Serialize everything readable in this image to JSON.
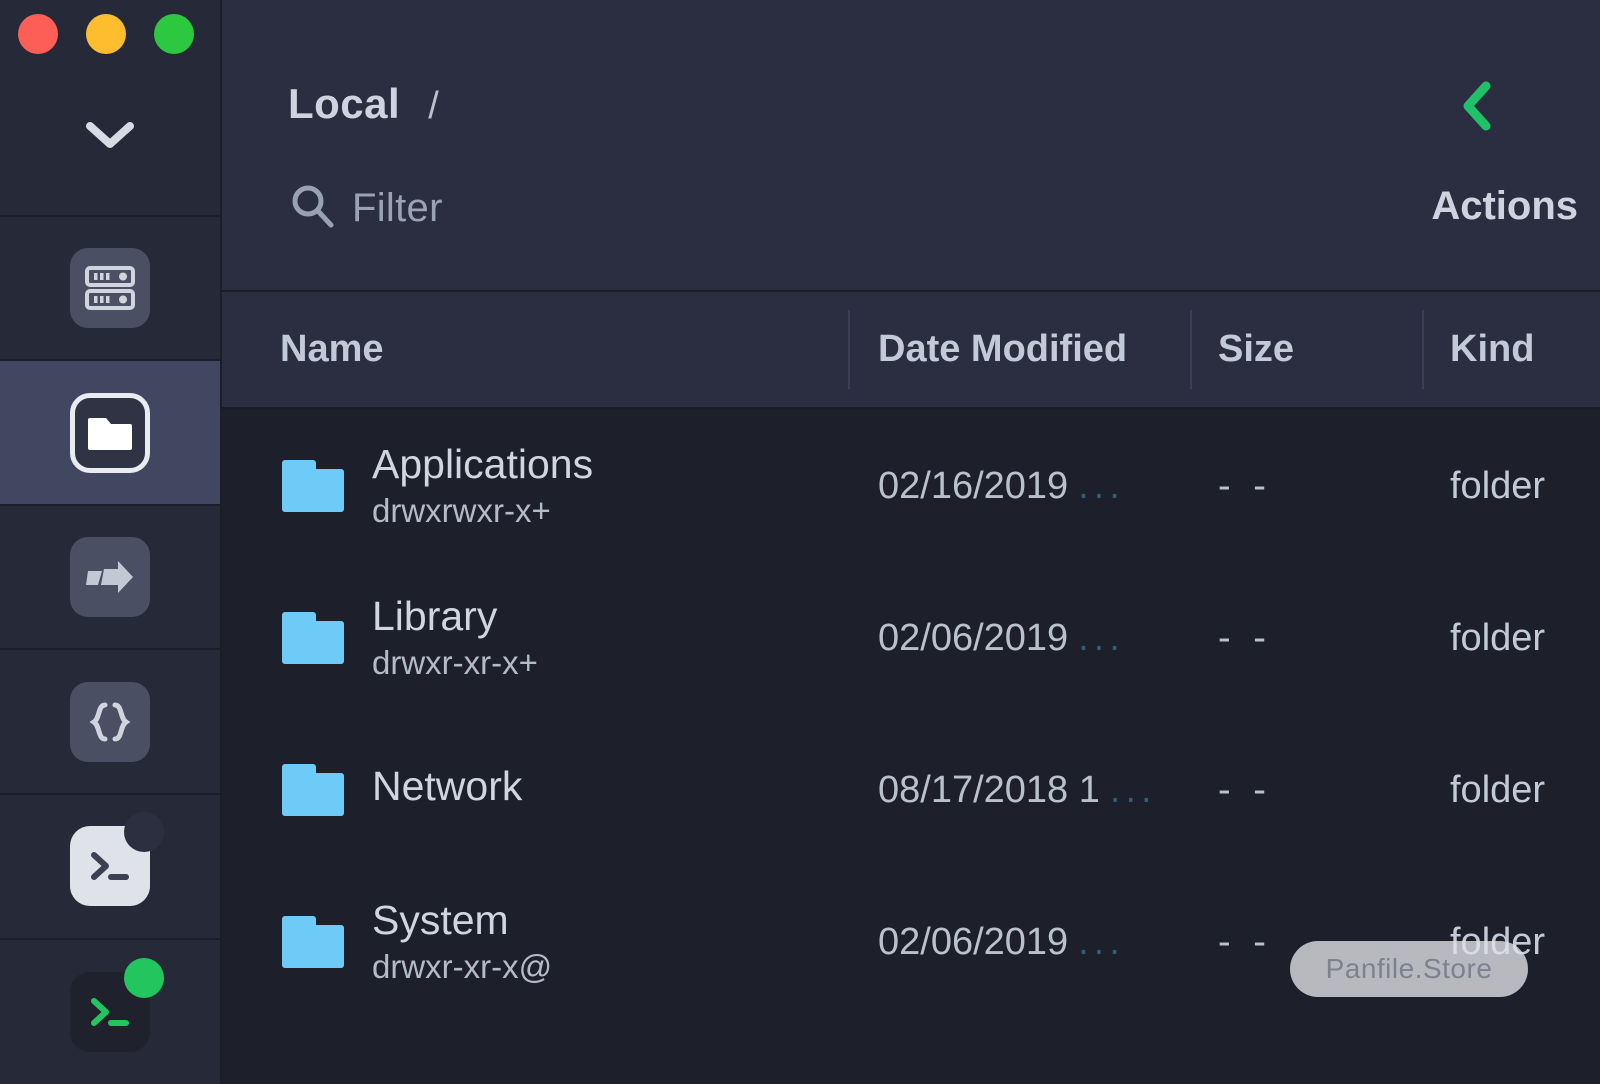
{
  "window": {
    "traffic_lights": [
      "close",
      "minimize",
      "zoom"
    ],
    "collapse_icon": "chevron-down-icon"
  },
  "sidebar": {
    "items": [
      {
        "icon": "server-icon",
        "label": "Servers",
        "selected": false
      },
      {
        "icon": "folder-icon",
        "label": "Files",
        "selected": true
      },
      {
        "icon": "transfers-arrow-icon",
        "label": "Transfers",
        "selected": false
      },
      {
        "icon": "code-braces-icon",
        "label": "Code",
        "selected": false
      },
      {
        "icon": "terminal-icon",
        "label": "Terminal",
        "selected": false,
        "badge": "dark"
      },
      {
        "icon": "terminal-active-icon",
        "label": "Session",
        "selected": false,
        "badge": "green"
      }
    ]
  },
  "toolbar": {
    "breadcrumb_root": "Local",
    "breadcrumb_separator": "/",
    "back_icon": "chevron-left-icon",
    "search_icon": "search-icon",
    "filter_placeholder": "Filter",
    "actions_label": "Actions"
  },
  "file_table": {
    "columns": [
      "Name",
      "Date Modified",
      "Size",
      "Kind"
    ],
    "rows": [
      {
        "icon": "folder-icon",
        "name": "Applications",
        "permissions": "drwxrwxr-x+",
        "date": "02/16/2019",
        "date_truncated": "...",
        "size": "- -",
        "kind": "folder"
      },
      {
        "icon": "folder-icon",
        "name": "Library",
        "permissions": "drwxr-xr-x+",
        "date": "02/06/2019",
        "date_truncated": "...",
        "size": "- -",
        "kind": "folder"
      },
      {
        "icon": "folder-icon",
        "name": "Network",
        "permissions": "",
        "date": "08/17/2018 1",
        "date_truncated": "...",
        "size": "- -",
        "kind": "folder"
      },
      {
        "icon": "folder-icon",
        "name": "System",
        "permissions": "drwxr-xr-x@",
        "date": "02/06/2019",
        "date_truncated": "...",
        "size": "- -",
        "kind": "folder"
      }
    ]
  },
  "watermark": {
    "text": "Panfile.Store"
  },
  "colors": {
    "sidebar_bg": "#262938",
    "sidebar_selected": "#414761",
    "toolbar_bg": "#2b2e40",
    "list_bg": "#1d1f2b",
    "folder_blue": "#6ecbf7",
    "accent_green": "#22c55e",
    "text_primary": "#cfd6e1",
    "text_secondary": "#b9c1cd"
  }
}
